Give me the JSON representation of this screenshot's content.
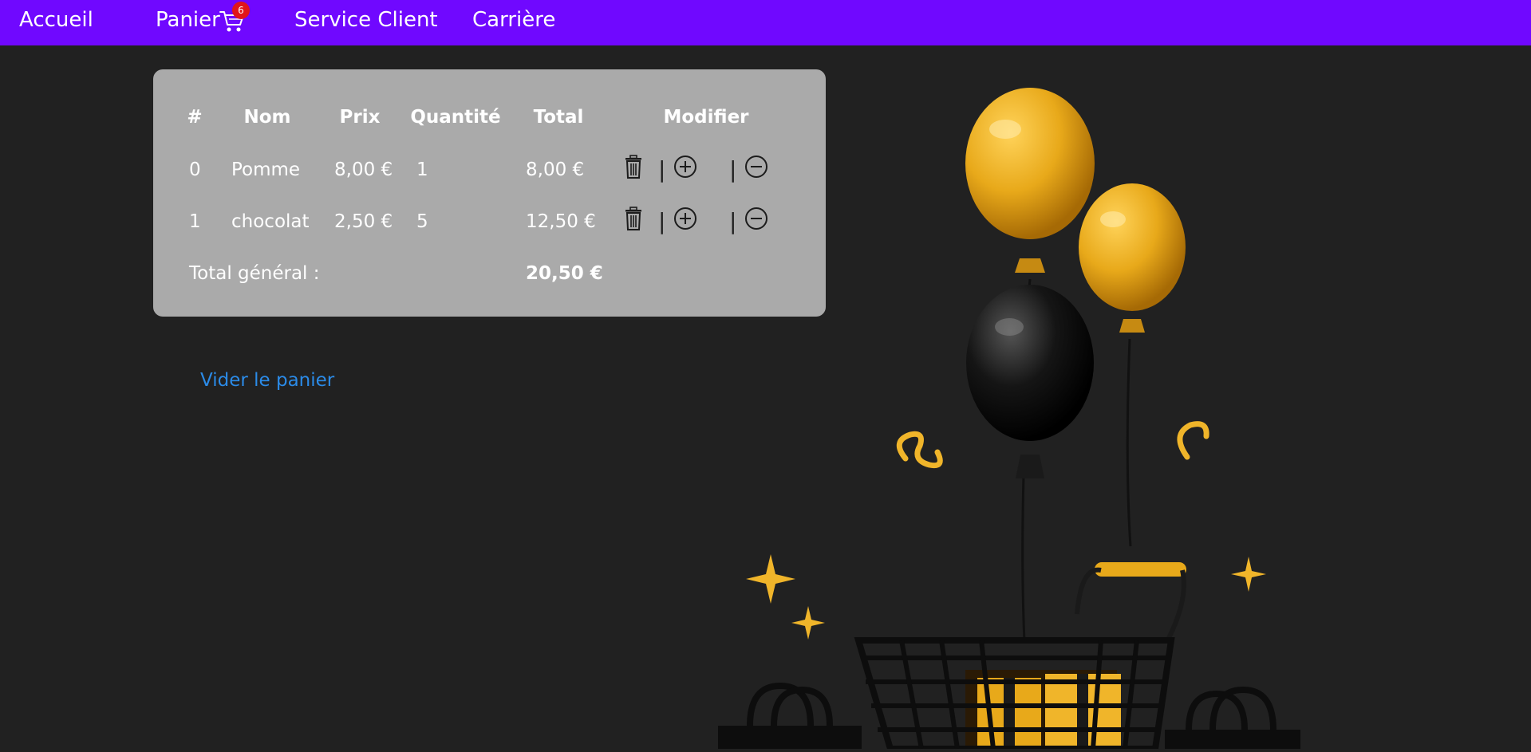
{
  "nav": {
    "home": "Accueil",
    "cart": "Panier",
    "cart_count": "6",
    "service": "Service Client",
    "career": "Carrière"
  },
  "cart": {
    "headers": {
      "index": "#",
      "name": "Nom",
      "price": "Prix",
      "quantity": "Quantité",
      "total": "Total",
      "modify": "Modifier"
    },
    "rows": [
      {
        "index": "0",
        "name": "Pomme",
        "price": "8,00 €",
        "quantity": "1",
        "total": "8,00 €"
      },
      {
        "index": "1",
        "name": "chocolat",
        "price": "2,50 €",
        "quantity": "5",
        "total": "12,50 €"
      }
    ],
    "separator": "|",
    "grand_total_label": "Total général :",
    "grand_total_value": "20,50 €"
  },
  "actions": {
    "empty_cart": "Vider le panier"
  },
  "icons": {
    "cart": "shopping-cart-icon",
    "delete": "trash-icon",
    "increase": "plus-circle-icon",
    "decrease": "minus-circle-icon"
  },
  "colors": {
    "navbar": "#7008ff",
    "background": "#212121",
    "panel": "#aaaaaa",
    "link": "#2b8be8",
    "badge": "#e0151b",
    "balloon_gold": "#e8a91a"
  }
}
